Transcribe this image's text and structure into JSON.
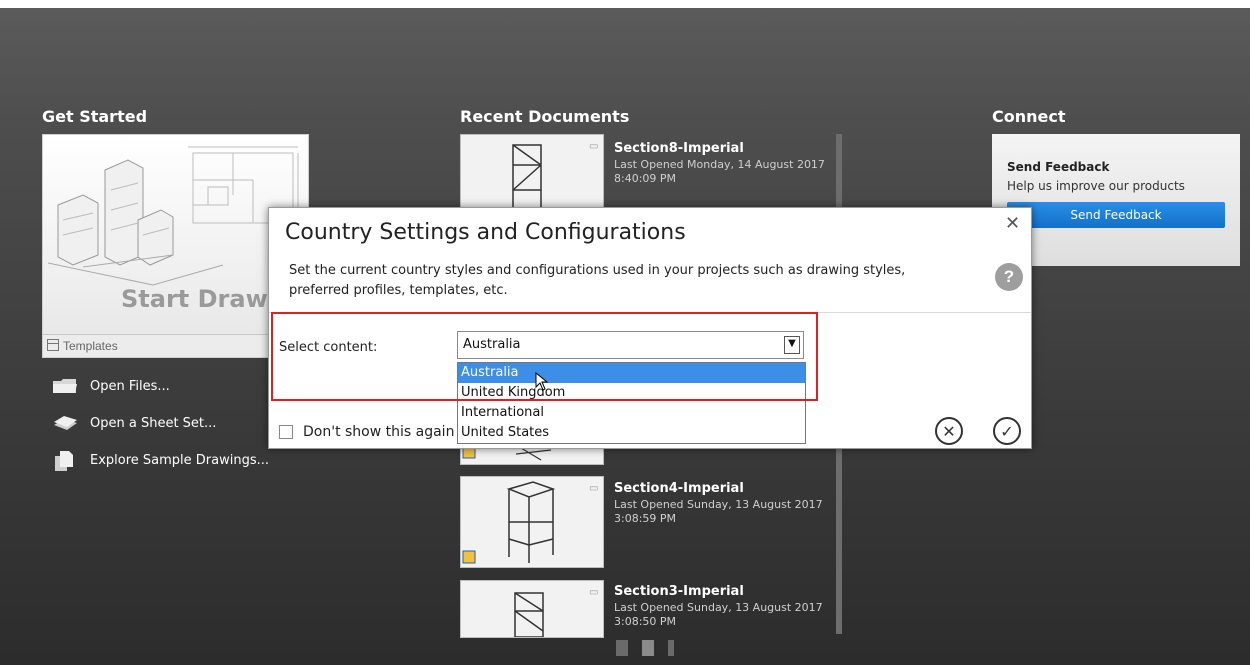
{
  "get_started": {
    "title": "Get Started",
    "start_label": "Start Drawing",
    "templates_label": "Templates",
    "links": [
      {
        "label": "Open Files...",
        "icon": "folder-icon"
      },
      {
        "label": "Open a Sheet Set...",
        "icon": "sheet-set-icon"
      },
      {
        "label": "Explore Sample Drawings...",
        "icon": "sample-drawings-icon"
      }
    ]
  },
  "recent": {
    "title": "Recent Documents",
    "documents": [
      {
        "name": "Section8-Imperial",
        "opened": "Last Opened Monday, 14 August 2017",
        "time": "8:40:09 PM"
      },
      {
        "name": "Section4-Imperial",
        "opened": "Last Opened Sunday, 13 August 2017",
        "time": "3:08:59 PM"
      },
      {
        "name": "Section3-Imperial",
        "opened": "Last Opened Sunday, 13 August 2017",
        "time": "3:08:50 PM"
      }
    ]
  },
  "connect": {
    "title": "Connect",
    "feedback_heading": "Send Feedback",
    "feedback_text": "Help us improve our products",
    "feedback_button": "Send Feedback"
  },
  "dialog": {
    "title": "Country Settings and Configurations",
    "description": "Set the current country styles and configurations used in your projects such as drawing styles, preferred profiles, templates, etc.",
    "close_glyph": "✕",
    "help_glyph": "?",
    "select_label": "Select content:",
    "selected_value": "Australia",
    "options": [
      "Australia",
      "United Kingdom",
      "International",
      "United States"
    ],
    "checkbox_label": "Don't show this again on startup",
    "cancel_glyph": "✕",
    "ok_glyph": "✓",
    "accent_color": "#3d8ee6",
    "highlight_color": "#e02020"
  }
}
